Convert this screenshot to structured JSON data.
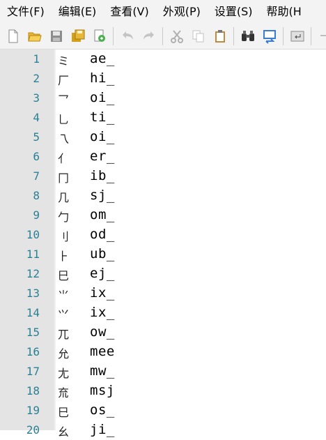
{
  "menubar": {
    "items": [
      "文件(F)",
      "编辑(E)",
      "查看(V)",
      "外观(P)",
      "设置(S)",
      "帮助(H"
    ]
  },
  "toolbar": {
    "icons": [
      "new-file-icon",
      "open-folder-icon",
      "save-icon",
      "save-all-icon",
      "reload-icon",
      "undo-icon",
      "redo-icon",
      "cut-icon",
      "copy-icon",
      "paste-icon",
      "find-icon",
      "replace-icon",
      "word-wrap-icon",
      "overflow-icon"
    ]
  },
  "colors": {
    "line_number": "#2b8094",
    "gutter": "#e4e4e4",
    "chrome": "#f3f3f3"
  },
  "editor": {
    "lines": [
      {
        "num": "1",
        "glyph": "ミ",
        "code": "ae_"
      },
      {
        "num": "2",
        "glyph": "厂",
        "code": "hi_"
      },
      {
        "num": "3",
        "glyph": "乛",
        "code": "oi_"
      },
      {
        "num": "4",
        "glyph": "乚",
        "code": "ti_"
      },
      {
        "num": "5",
        "glyph": "乁",
        "code": "oi_"
      },
      {
        "num": "6",
        "glyph": "亻",
        "code": "er_"
      },
      {
        "num": "7",
        "glyph": "冂",
        "code": "ib_"
      },
      {
        "num": "8",
        "glyph": "几",
        "code": "sj_"
      },
      {
        "num": "9",
        "glyph": "勹",
        "code": "om_"
      },
      {
        "num": "10",
        "glyph": "刂",
        "code": "od_"
      },
      {
        "num": "11",
        "glyph": "⺊",
        "code": "ub_"
      },
      {
        "num": "12",
        "glyph": "巳",
        "code": "ej_"
      },
      {
        "num": "13",
        "glyph": "⺌",
        "code": "ix_"
      },
      {
        "num": "14",
        "glyph": "⺍",
        "code": "ix_"
      },
      {
        "num": "15",
        "glyph": "兀",
        "code": "ow_"
      },
      {
        "num": "16",
        "glyph": "允",
        "code": "mee"
      },
      {
        "num": "17",
        "glyph": "尢",
        "code": "mw_"
      },
      {
        "num": "18",
        "glyph": "㐬",
        "code": "msj"
      },
      {
        "num": "19",
        "glyph": "巳",
        "code": "os_"
      },
      {
        "num": "20",
        "glyph": "幺",
        "code": "ji_"
      }
    ]
  }
}
